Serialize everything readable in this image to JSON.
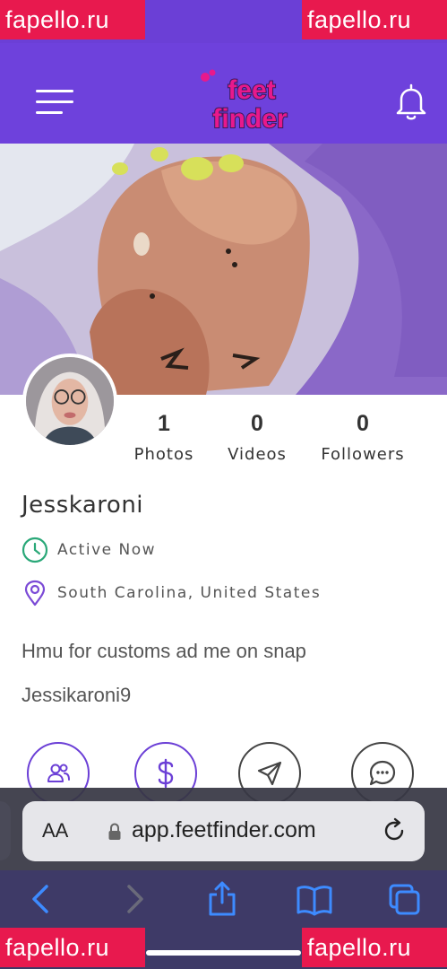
{
  "watermarks": [
    "fapello.ru",
    "fapello.ru",
    "fapello.ru",
    "fapello.ru"
  ],
  "header": {
    "logo_line1": "feet",
    "logo_line2": "finder",
    "menu_icon": "hamburger-icon",
    "notification_icon": "bell-icon"
  },
  "profile": {
    "username": "Jesskaroni",
    "stats": [
      {
        "value": "1",
        "label": "Photos"
      },
      {
        "value": "0",
        "label": "Videos"
      },
      {
        "value": "0",
        "label": "Followers"
      }
    ],
    "status": "Active Now",
    "location": "South Carolina, United States",
    "bio_line1": "Hmu for customs ad me on snap",
    "bio_line2": "Jessikaroni9"
  },
  "actions": [
    {
      "icon": "users-icon"
    },
    {
      "icon": "dollar-icon"
    },
    {
      "icon": "send-icon"
    },
    {
      "icon": "chat-icon"
    }
  ],
  "browser": {
    "aa_label": "AA",
    "url": "app.feetfinder.com"
  },
  "colors": {
    "brand_purple": "#6e41dc",
    "logo_pink": "#e8198c",
    "active_green": "#2aa878",
    "location_purple": "#7b4ad6"
  }
}
